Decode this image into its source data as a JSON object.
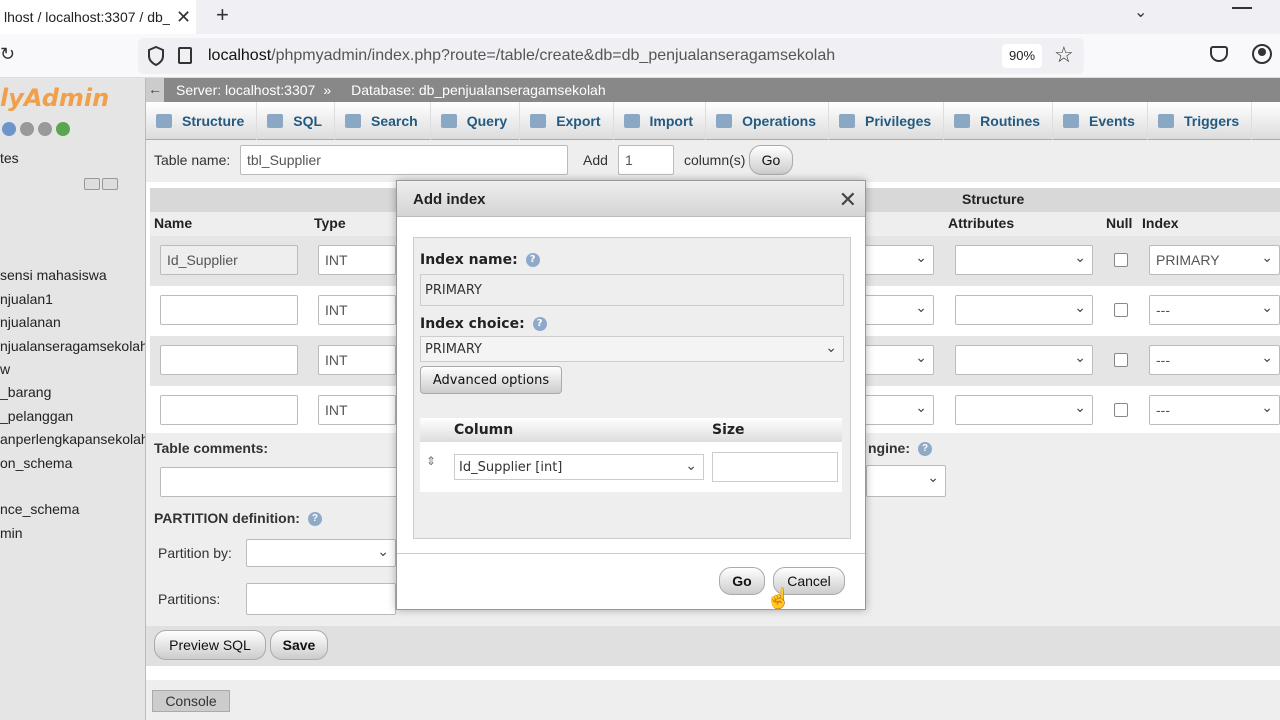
{
  "browser": {
    "tab_title": "lhost / localhost:3307 / db_",
    "new_tab": "+",
    "url_host": "localhost",
    "url_path": "/phpmyadmin/index.php?route=/table/create&db=db_penjualanseragamsekolah",
    "zoom": "90%"
  },
  "sidebar": {
    "logo": "lyAdmin",
    "recent_label": "tes",
    "databases": [
      "",
      "sensi mahasiswa",
      "njualan1",
      "njualanan",
      "njualanseragamsekolah",
      "w",
      "_barang",
      "_pelanggan",
      "anperlengkapansekolah",
      "on_schema",
      "",
      "nce_schema",
      "min"
    ]
  },
  "breadcrumb": {
    "server": "Server: localhost:3307",
    "separator": "»",
    "database": "Database: db_penjualanseragamsekolah"
  },
  "menu": {
    "tabs": [
      "Structure",
      "SQL",
      "Search",
      "Query",
      "Export",
      "Import",
      "Operations",
      "Privileges",
      "Routines",
      "Events",
      "Triggers"
    ]
  },
  "create_form": {
    "table_name_label": "Table name:",
    "table_name_value": "tbl_Supplier",
    "add_label": "Add",
    "add_value": "1",
    "columns_label": "column(s)",
    "go_label": "Go",
    "structure_label": "Structure",
    "headers": {
      "name": "Name",
      "type": "Type",
      "attributes": "Attributes",
      "null": "Null",
      "index": "Index"
    },
    "rows": [
      {
        "name": "Id_Supplier",
        "type": "INT",
        "index": "PRIMARY"
      },
      {
        "name": "",
        "type": "INT",
        "index": "---"
      },
      {
        "name": "",
        "type": "INT",
        "index": "---"
      },
      {
        "name": "",
        "type": "INT",
        "index": "---"
      }
    ],
    "table_comments_label": "Table comments:",
    "engine_label": "ngine:",
    "partition_label": "PARTITION definition:",
    "partition_by_label": "Partition by:",
    "partitions_label": "Partitions:",
    "preview_sql": "Preview SQL",
    "save": "Save",
    "console": "Console"
  },
  "dialog": {
    "title": "Add index",
    "index_name_label": "Index name:",
    "index_name_value": "PRIMARY",
    "index_choice_label": "Index choice:",
    "index_choice_value": "PRIMARY",
    "advanced_options": "Advanced options",
    "column_header": "Column",
    "size_header": "Size",
    "column_value": "Id_Supplier [int]",
    "size_value": "",
    "go": "Go",
    "cancel": "Cancel"
  }
}
